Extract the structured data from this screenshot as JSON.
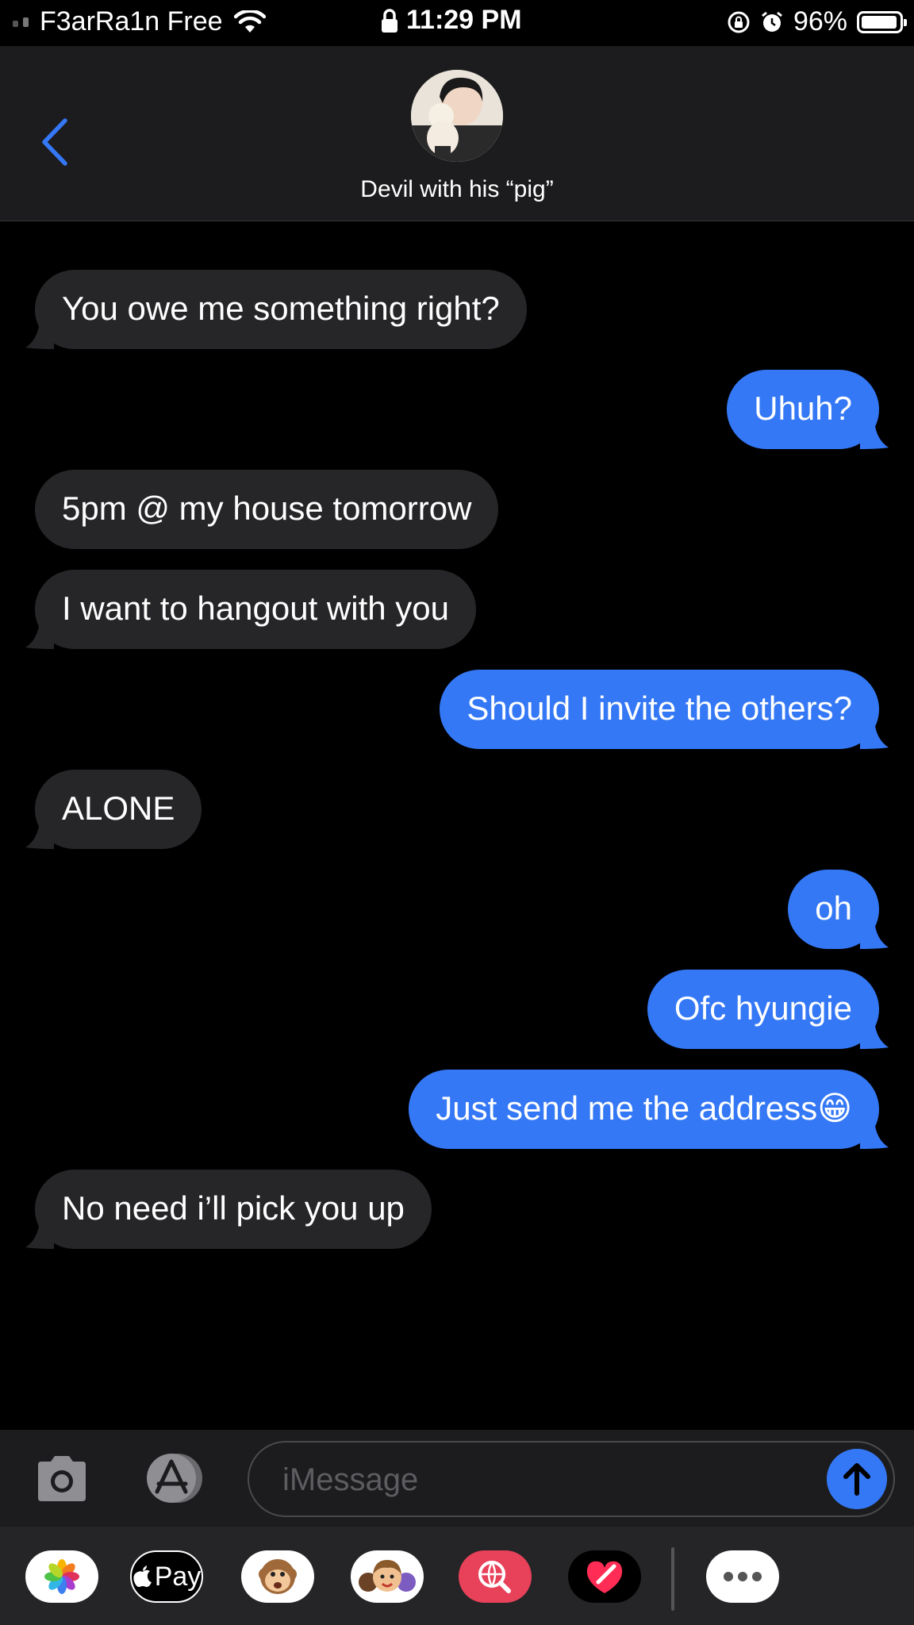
{
  "status_bar": {
    "carrier": "F3arRa1n Free",
    "time": "11:29 PM",
    "battery_percent": "96%",
    "battery_level": 0.96
  },
  "header": {
    "contact_name": "Devil with his “pig”"
  },
  "messages": [
    {
      "side": "in",
      "text": "You owe me something right?"
    },
    {
      "side": "out",
      "text": "Uhuh?"
    },
    {
      "side": "in",
      "text": "5pm @ my house tomorrow"
    },
    {
      "side": "in",
      "text": "I want to hangout with you"
    },
    {
      "side": "out",
      "text": "Should I invite the others?"
    },
    {
      "side": "in",
      "text": "ALONE"
    },
    {
      "side": "out",
      "text": "oh"
    },
    {
      "side": "out",
      "text": "Ofc hyungie"
    },
    {
      "side": "out",
      "text": "Just send me the address😁"
    },
    {
      "side": "in",
      "text": "No need i’ll pick you up"
    }
  ],
  "input": {
    "placeholder": "iMessage",
    "value": ""
  },
  "app_drawer": {
    "apple_pay_label": "Pay",
    "apps": [
      "photos-app",
      "apple-pay-app",
      "animoji-app",
      "memoji-app",
      "image-search-app",
      "digital-touch-app",
      "more-apps"
    ]
  },
  "colors": {
    "outgoing_bubble": "#3478f6",
    "incoming_bubble": "#262628",
    "back_chevron": "#3478f6"
  }
}
